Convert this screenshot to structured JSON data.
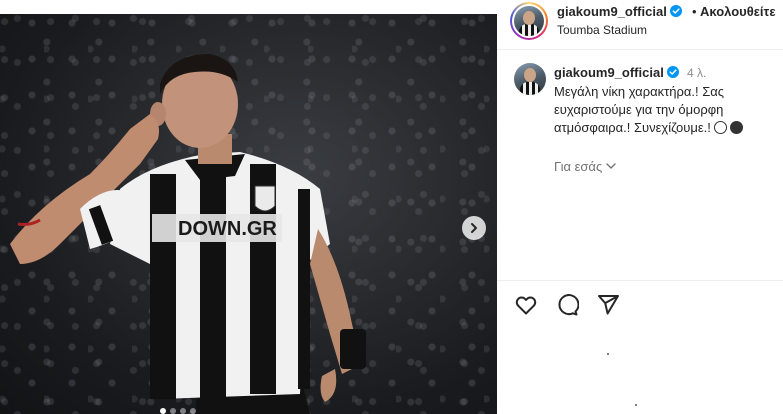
{
  "post": {
    "image_alt": "",
    "carousel": {
      "dot_count": 4,
      "active_index": 0
    }
  },
  "header": {
    "username": "giakoum9_official",
    "separator": "•",
    "follow_label": "Ακολουθείτε",
    "location": "Toumba Stadium"
  },
  "caption": {
    "username": "giakoum9_official",
    "time": "4 λ.",
    "text": "Μεγάλη νίκη χαρακτήρα.! Σας ευχαριστούμε για την όμορφη ατμόσφαιρα.! Συνεχίζουμε.!"
  },
  "for_you_label": "Για εσάς",
  "actions": [
    "heart-icon",
    "comment-icon",
    "share-icon"
  ],
  "colors": {
    "verified": "#0095f6",
    "text": "#262626",
    "muted": "#8e8e8e"
  }
}
